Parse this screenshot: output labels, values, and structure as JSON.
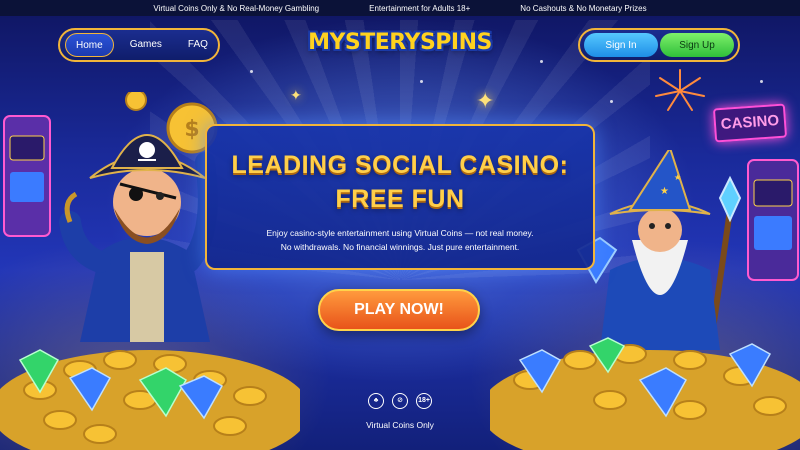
{
  "topbar": {
    "items": [
      "Virtual Coins Only & No Real-Money Gambling",
      "Entertainment for Adults 18+",
      "No Cashouts & No Monetary Prizes"
    ]
  },
  "nav": {
    "items": [
      {
        "label": "Home",
        "active": true
      },
      {
        "label": "Games",
        "active": false
      },
      {
        "label": "FAQ",
        "active": false
      }
    ]
  },
  "logo": {
    "text": "MYSTERYSPINS"
  },
  "auth": {
    "signin_label": "Sign In",
    "signup_label": "Sign Up"
  },
  "hero": {
    "title_line1": "LEADING SOCIAL CASINO:",
    "title_line2": "FREE FUN",
    "desc_line1": "Enjoy casino-style entertainment using Virtual Coins — not real money.",
    "desc_line2": "No withdrawals. No financial winnings. Just pure entertainment."
  },
  "cta": {
    "play_label": "PLAY NOW!"
  },
  "background": {
    "casino_sign": "CASINO"
  },
  "badges": {
    "age_badge": "18+",
    "icons": [
      "responsible-gaming-icon",
      "no-cash-icon",
      "age-18-badge"
    ]
  },
  "footer": {
    "note": "Virtual Coins Only"
  },
  "colors": {
    "accent_gold": "#f2b53a",
    "signin": "#1e8ee6",
    "signup": "#2fbf3a",
    "play": "#e8531a",
    "bg": "#1a2a9a"
  }
}
